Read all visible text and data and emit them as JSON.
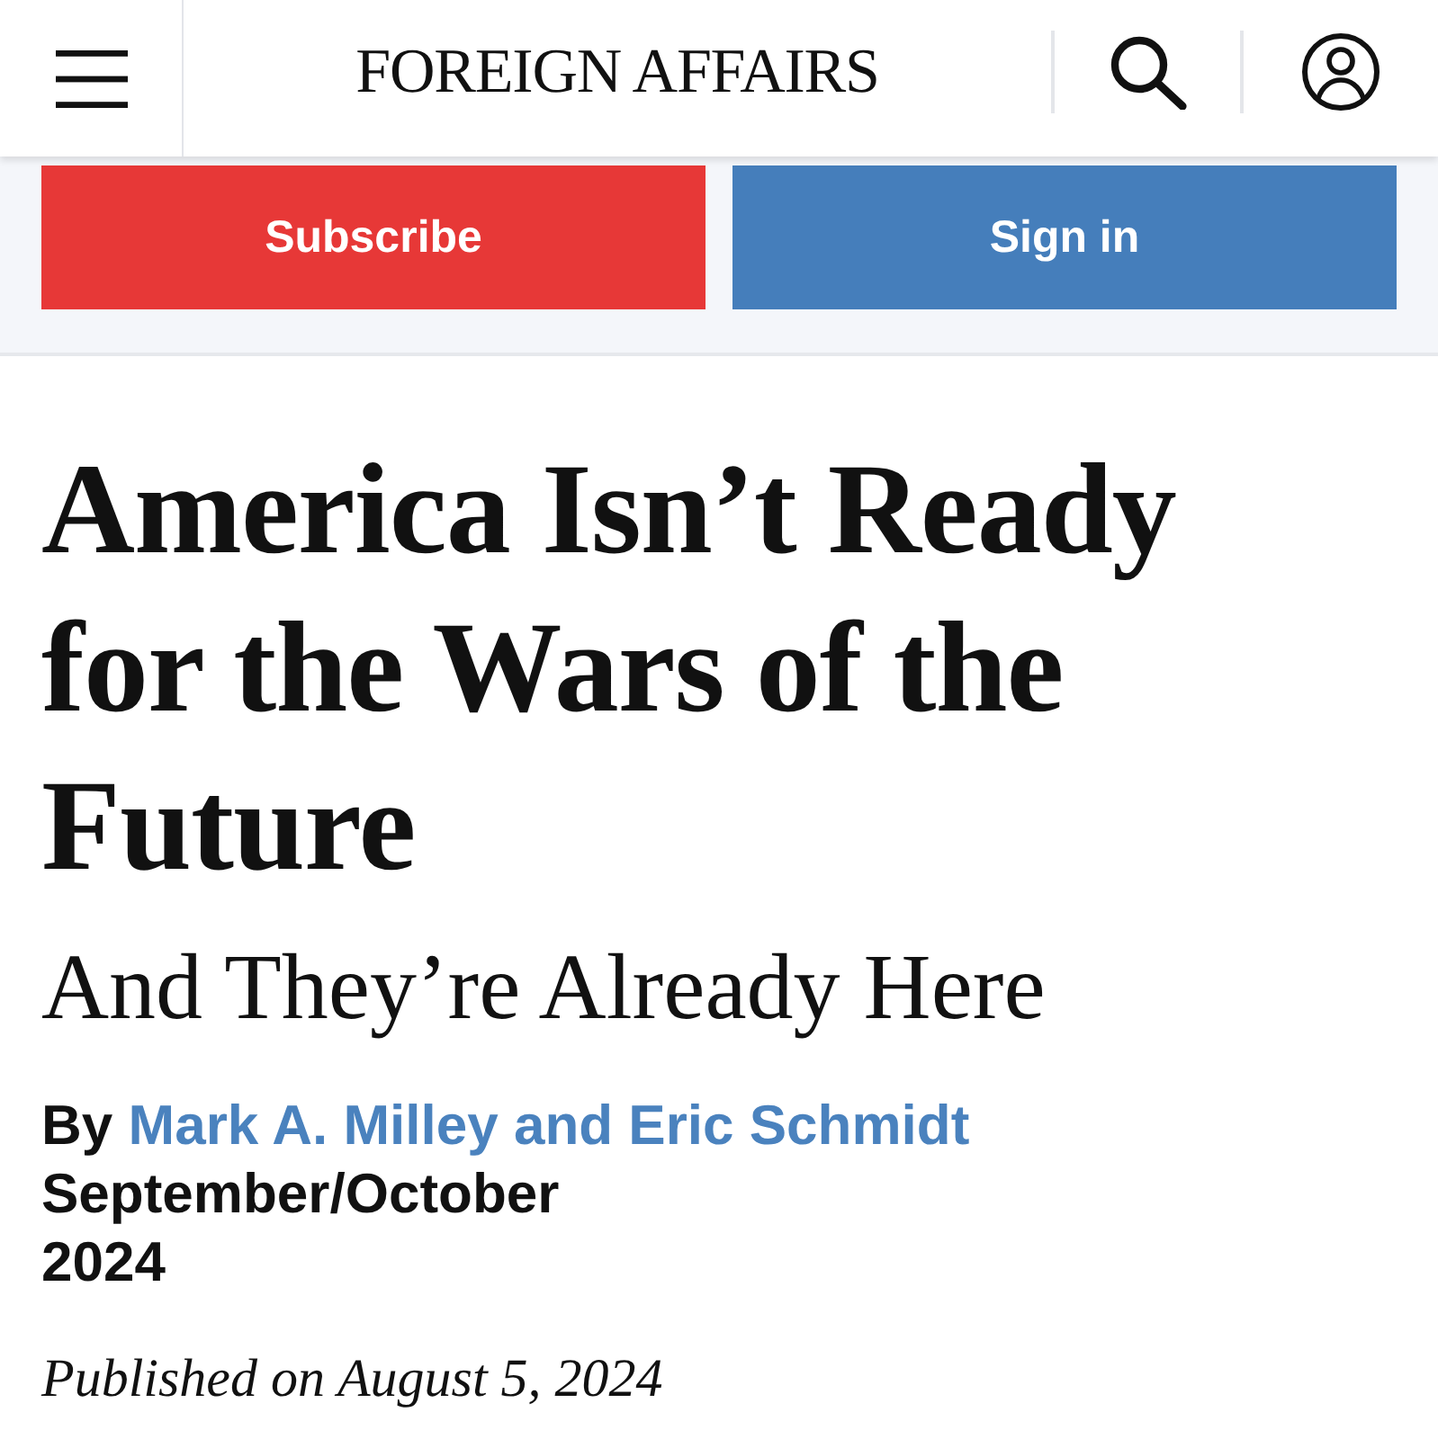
{
  "header": {
    "logo": "FOREIGN AFFAIRS"
  },
  "actions": [
    {
      "label": "Subscribe",
      "kind": "subscribe"
    },
    {
      "label": "Sign in",
      "kind": "signin"
    }
  ],
  "article": {
    "title": "America Isn’t Ready for the Wars of the Future",
    "subtitle": "And They’re Already Here",
    "byline": {
      "prefix": "By",
      "authors": "Mark A. Milley and Eric Schmidt"
    },
    "issue": "September/October 2024",
    "published": "Published on August 5, 2024"
  }
}
